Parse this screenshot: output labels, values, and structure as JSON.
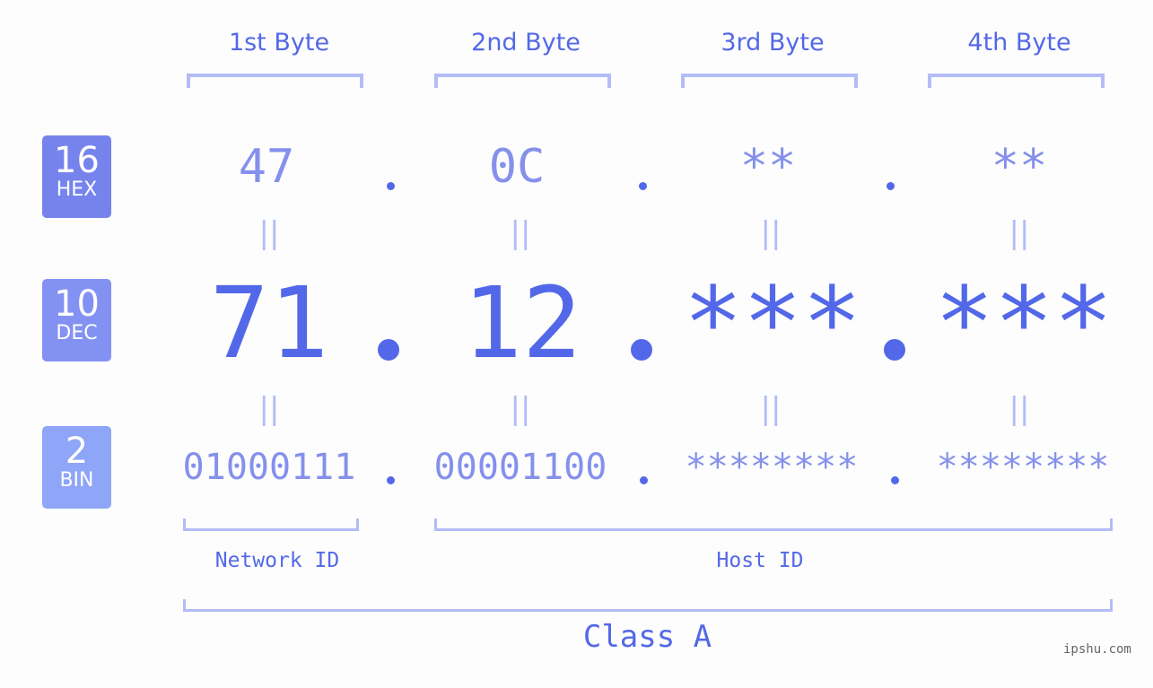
{
  "bytes": {
    "headers": [
      "1st Byte",
      "2nd Byte",
      "3rd Byte",
      "4th Byte"
    ]
  },
  "bases": [
    {
      "number": "16",
      "label": "HEX",
      "color": "#7783ec"
    },
    {
      "number": "10",
      "label": "DEC",
      "color": "#8392f2"
    },
    {
      "number": "2",
      "label": "BIN",
      "color": "#8ea5f8"
    }
  ],
  "rows": {
    "hex": [
      "47",
      "0C",
      "**",
      "**"
    ],
    "dec": [
      "71",
      "12",
      "***",
      "***"
    ],
    "bin": [
      "01000111",
      "00001100",
      "********",
      "********"
    ]
  },
  "separator": ".",
  "equals_sign": "||",
  "segments": {
    "network_id": "Network ID",
    "host_id": "Host ID",
    "class_label": "Class A"
  },
  "watermark": "ipshu.com",
  "colors": {
    "accent": "#5368e8",
    "light_accent": "#8590ec",
    "bracket": "#b3bcf6",
    "background": "#fcfdfc"
  }
}
